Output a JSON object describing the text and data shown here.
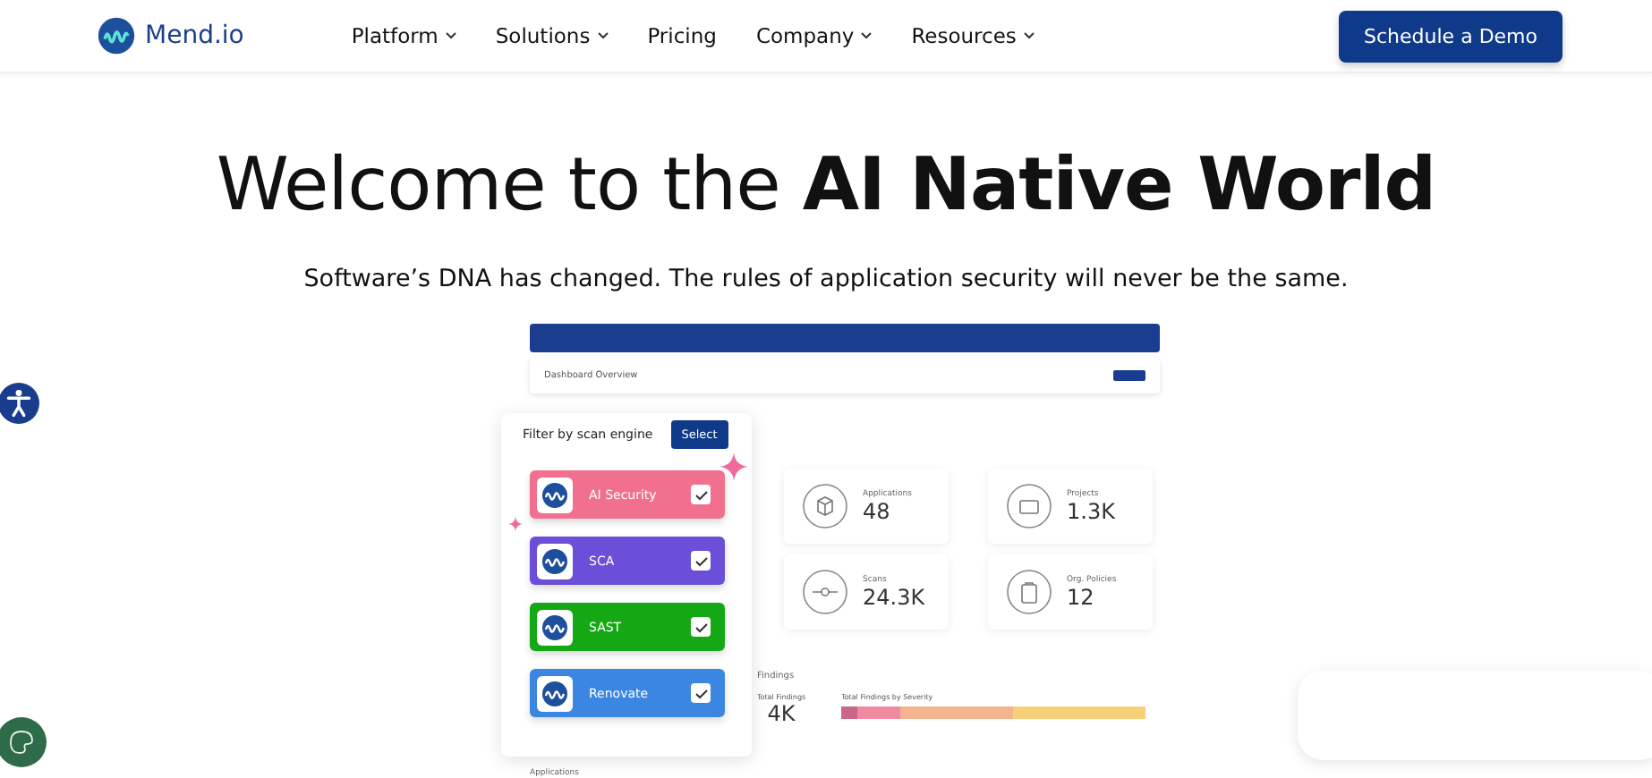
{
  "nav": {
    "logo": "Mend.io",
    "items": [
      {
        "label": "Platform",
        "dropdown": true
      },
      {
        "label": "Solutions",
        "dropdown": true
      },
      {
        "label": "Pricing",
        "dropdown": false
      },
      {
        "label": "Company",
        "dropdown": true
      },
      {
        "label": "Resources",
        "dropdown": true
      }
    ],
    "cta": "Schedule a Demo"
  },
  "hero": {
    "title": "Welcome to the **AI Native World**",
    "subtitle": "Software’s DNA has changed. The rules of application security will never be the same."
  },
  "dashboard": {
    "title": "Dashboard Overview",
    "filter": {
      "label": "Filter by scan engine",
      "button": "Select",
      "engines": [
        {
          "name": "AI Security",
          "color": "#f2708f",
          "checked": true
        },
        {
          "name": "SCA",
          "color": "#6b4fd8",
          "checked": true
        },
        {
          "name": "SAST",
          "color": "#14a814",
          "checked": true
        },
        {
          "name": "Renovate",
          "color": "#3b86e0",
          "checked": true
        }
      ]
    },
    "stats": [
      {
        "label": "Applications",
        "value": "48",
        "kind": "cube"
      },
      {
        "label": "Projects",
        "value": "1.3K",
        "kind": "folder"
      },
      {
        "label": "Scans",
        "value": "24.3K",
        "kind": "commit"
      },
      {
        "label": "Org. Policies",
        "value": "12",
        "kind": "clipboard"
      }
    ],
    "findings": {
      "title": "Findings",
      "total_label": "Total Findings",
      "total": "4K",
      "severity_label": "Total Findings by Severity"
    },
    "applications_label": "Applications"
  }
}
